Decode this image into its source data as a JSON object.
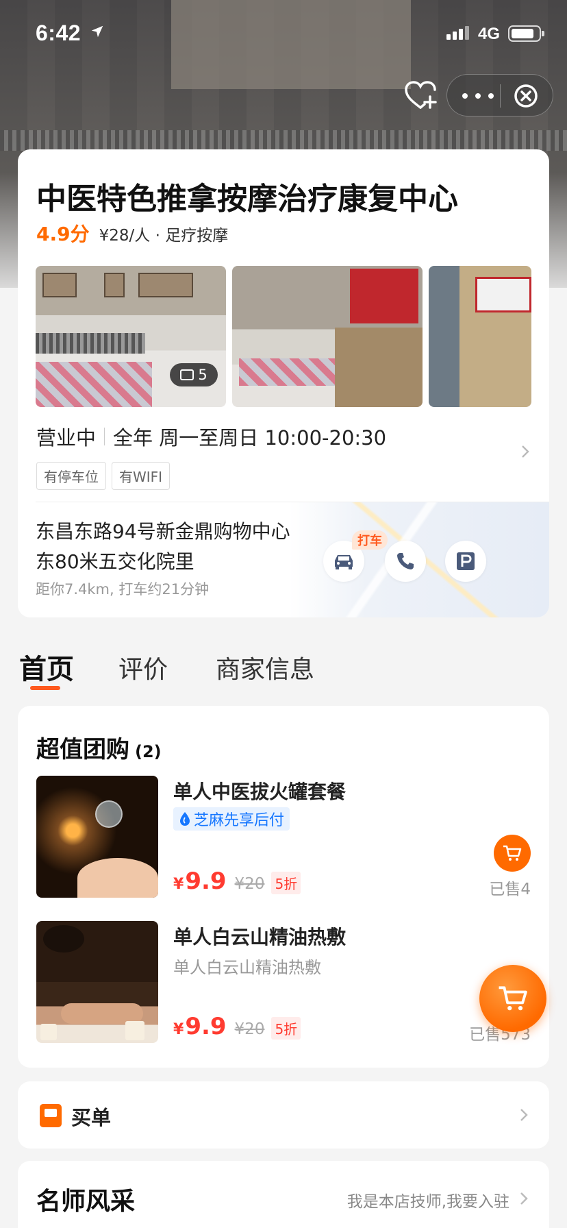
{
  "status_bar": {
    "time": "6:42",
    "network": "4G"
  },
  "shop": {
    "name": "中医特色推拿按摩治疗康复中心",
    "rating": "4.9分",
    "price_category": "¥28/人 · 足疗按摩",
    "photo_count": "5",
    "status": "营业中",
    "hours": "全年 周一至周日 10:00-20:30",
    "tags": [
      "有停车位",
      "有WIFI"
    ],
    "address_line1": "东昌东路94号新金鼎购物中心",
    "address_line2": "东80米五交化院里",
    "distance": "距你7.4km, 打车约21分钟",
    "taxi_badge": "打车"
  },
  "tabs": [
    {
      "label": "首页",
      "active": true
    },
    {
      "label": "评价",
      "active": false
    },
    {
      "label": "商家信息",
      "active": false
    }
  ],
  "deals": {
    "title": "超值团购",
    "count": "(2)",
    "items": [
      {
        "name": "单人中医拔火罐套餐",
        "badge": "芝麻先享后付",
        "currency": "¥",
        "price": "9.9",
        "original_price": "¥20",
        "discount": "5折",
        "sold": "已售4"
      },
      {
        "name": "单人白云山精油热敷",
        "subtitle": "单人白云山精油热敷",
        "currency": "¥",
        "price": "9.9",
        "original_price": "¥20",
        "discount": "5折",
        "sold": "已售573"
      }
    ]
  },
  "pay": {
    "label": "买单"
  },
  "teachers": {
    "title": "名师风采",
    "join_link": "我是本店技师,我要入驻"
  },
  "colors": {
    "accent": "#ff6a00",
    "price": "#ff3b30",
    "alipay_blue": "#1677ff"
  }
}
